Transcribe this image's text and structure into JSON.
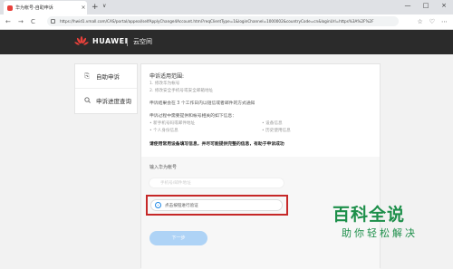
{
  "browser": {
    "tab_title": "华为帐号-自助申诉",
    "tab_close": "×",
    "new_tab": "+",
    "tab_menu": "∨",
    "window_controls": [
      "—",
      "□",
      "×"
    ],
    "nav": [
      "←",
      "→",
      "C"
    ],
    "url": "https://hwid1.vmall.com/CAS/portal/appeal/selfApplyChange4Account.html?reqClientType=1&loginChannel=1000002&countryCode=cn&loginUrl=https%3A%2F%2F",
    "toolbar_icons": [
      "☆",
      "♡",
      "⋯"
    ]
  },
  "header": {
    "brand": "HUAWEI",
    "product": "云空间"
  },
  "sidebar": {
    "items": [
      {
        "icon": "document-icon",
        "glyph": "⎘",
        "label": "自助申诉"
      },
      {
        "icon": "search-icon",
        "glyph": "🔍",
        "label": "申诉进度查询"
      }
    ]
  },
  "main": {
    "scope_title": "申诉适用范围:",
    "scope_items": [
      "1. 修改华为帐号",
      "2. 修改安全手机号或安全邮箱地址"
    ],
    "result_note": "申诉结果会在 3 个工作日内以短信或者邮件的方式通知",
    "info_intro": "申诉过程中需要提供和帐号相关的如下信息：",
    "info_items": [
      "• 新手机号码或邮件地址",
      "• 设备信息",
      "• 个人身份信息",
      "• 历史使用信息"
    ],
    "warning": "请使用常用设备填写信息，并尽可能提供完整的信息，有助于申诉成功",
    "account_label": "输入华为帐号",
    "account_placeholder": "手机号/邮件地址",
    "verify_text": "点击按钮进行验证",
    "next_button": "下一步"
  },
  "watermark": {
    "main": "百科全说",
    "sub": "助你轻松解决"
  }
}
